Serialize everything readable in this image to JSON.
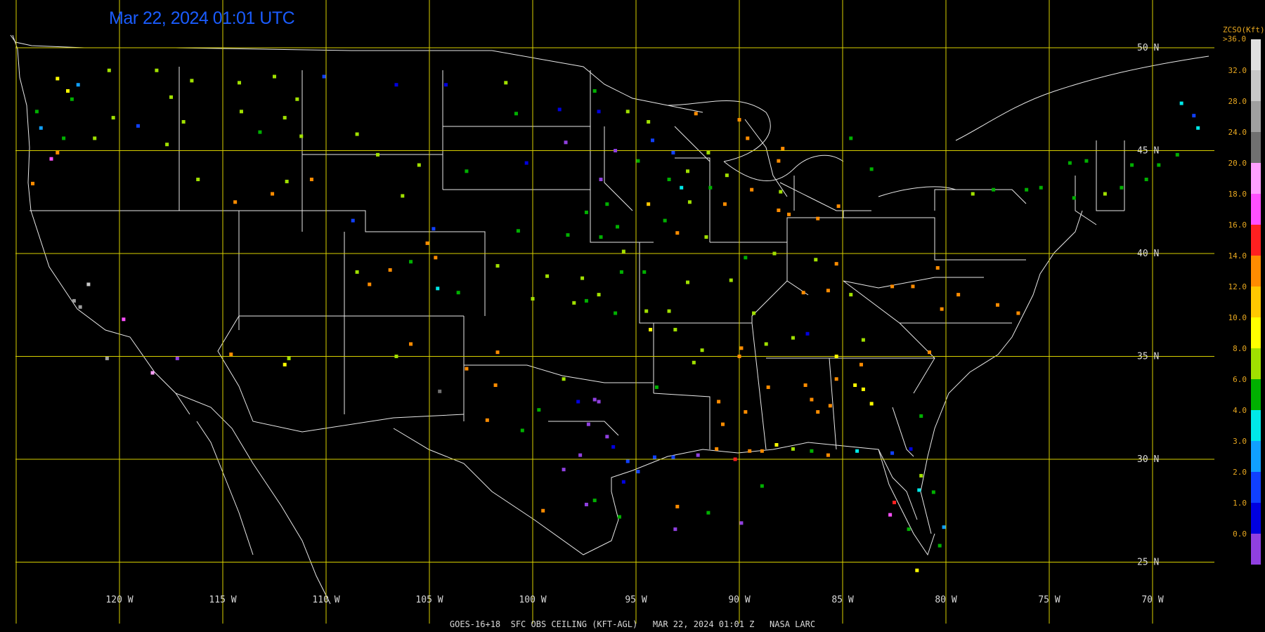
{
  "timestamp": "Mar 22, 2024 01:01 UTC",
  "footer": "GOES-16+18  SFC OBS CEILING (KFT-AGL)   MAR 22, 2024 01:01 Z   NASA LARC",
  "map": {
    "lat_lines": [
      {
        "lat": 50,
        "label": "50 N"
      },
      {
        "lat": 45,
        "label": "45 N"
      },
      {
        "lat": 40,
        "label": "40 N"
      },
      {
        "lat": 35,
        "label": "35 N"
      },
      {
        "lat": 30,
        "label": "30 N"
      },
      {
        "lat": 25,
        "label": "25 N"
      }
    ],
    "lon_lines": [
      {
        "lon": -125,
        "label": ""
      },
      {
        "lon": -120,
        "label": "120 W"
      },
      {
        "lon": -115,
        "label": "115 W"
      },
      {
        "lon": -110,
        "label": "110 W"
      },
      {
        "lon": -105,
        "label": "105 W"
      },
      {
        "lon": -100,
        "label": "100 W"
      },
      {
        "lon": -95,
        "label": "95 W"
      },
      {
        "lon": -90,
        "label": "90 W"
      },
      {
        "lon": -85,
        "label": "85 W"
      },
      {
        "lon": -80,
        "label": "80 W"
      },
      {
        "lon": -75,
        "label": "75 W"
      },
      {
        "lon": -70,
        "label": "70 W"
      }
    ],
    "grid_color": "#d8d000",
    "boundary_color": "#e8e8e8"
  },
  "colorbar": {
    "title": "ZCSO(Kft)",
    "top_label": ">36.0",
    "labels": [
      "32.0",
      "28.0",
      "24.0",
      "20.0",
      "18.0",
      "16.0",
      "14.0",
      "12.0",
      "10.0",
      "8.0",
      "6.0",
      "4.0",
      "3.0",
      "2.0",
      "1.0",
      "0.0"
    ],
    "colors": [
      "#e0e0e0",
      "#c8c8c8",
      "#a0a0a0",
      "#707070",
      "#ffa0ff",
      "#ff50ff",
      "#ff2020",
      "#ff8c00",
      "#ffc800",
      "#ffff00",
      "#a0e000",
      "#00b000",
      "#00e8e8",
      "#10a0ff",
      "#1040ff",
      "#0000e0",
      "#9040e0"
    ]
  },
  "observations": [
    {
      "lon": -122.3,
      "lat": 47.5,
      "v": 5
    },
    {
      "lon": -122.5,
      "lat": 47.9,
      "v": 7
    },
    {
      "lon": -123.0,
      "lat": 48.5,
      "v": 7
    },
    {
      "lon": -122.0,
      "lat": 48.2,
      "v": 3
    },
    {
      "lon": -124.0,
      "lat": 46.9,
      "v": 5
    },
    {
      "lon": -123.8,
      "lat": 46.1,
      "v": 3
    },
    {
      "lon": -122.7,
      "lat": 45.6,
      "v": 5
    },
    {
      "lon": -123.0,
      "lat": 44.9,
      "v": 9
    },
    {
      "lon": -124.2,
      "lat": 43.4,
      "v": 9
    },
    {
      "lon": -123.3,
      "lat": 44.6,
      "v": 11
    },
    {
      "lon": -121.2,
      "lat": 45.6,
      "v": 6
    },
    {
      "lon": -120.3,
      "lat": 46.6,
      "v": 6
    },
    {
      "lon": -119.1,
      "lat": 46.2,
      "v": 2
    },
    {
      "lon": -117.5,
      "lat": 47.6,
      "v": 6
    },
    {
      "lon": -116.9,
      "lat": 46.4,
      "v": 6
    },
    {
      "lon": -120.5,
      "lat": 48.9,
      "v": 6
    },
    {
      "lon": -118.2,
      "lat": 48.9,
      "v": 6
    },
    {
      "lon": -116.5,
      "lat": 48.4,
      "v": 6
    },
    {
      "lon": -114.2,
      "lat": 48.3,
      "v": 6
    },
    {
      "lon": -112.5,
      "lat": 48.6,
      "v": 6
    },
    {
      "lon": -111.4,
      "lat": 47.5,
      "v": 6
    },
    {
      "lon": -110.1,
      "lat": 48.6,
      "v": 2
    },
    {
      "lon": -108.5,
      "lat": 45.8,
      "v": 6
    },
    {
      "lon": -112.0,
      "lat": 46.6,
      "v": 6
    },
    {
      "lon": -114.1,
      "lat": 46.9,
      "v": 6
    },
    {
      "lon": -113.2,
      "lat": 45.9,
      "v": 5
    },
    {
      "lon": -111.2,
      "lat": 45.7,
      "v": 6
    },
    {
      "lon": -106.6,
      "lat": 48.2,
      "v": 1
    },
    {
      "lon": -104.2,
      "lat": 48.2,
      "v": 1
    },
    {
      "lon": -107.5,
      "lat": 44.8,
      "v": 6
    },
    {
      "lon": -105.5,
      "lat": 44.3,
      "v": 6
    },
    {
      "lon": -104.8,
      "lat": 41.2,
      "v": 2
    },
    {
      "lon": -106.3,
      "lat": 42.8,
      "v": 6
    },
    {
      "lon": -108.7,
      "lat": 41.6,
      "v": 2
    },
    {
      "lon": -110.7,
      "lat": 43.6,
      "v": 9
    },
    {
      "lon": -112.6,
      "lat": 42.9,
      "v": 9
    },
    {
      "lon": -111.9,
      "lat": 43.5,
      "v": 6
    },
    {
      "lon": -114.4,
      "lat": 42.5,
      "v": 9
    },
    {
      "lon": -116.2,
      "lat": 43.6,
      "v": 6
    },
    {
      "lon": -117.7,
      "lat": 45.3,
      "v": 6
    },
    {
      "lon": -101.3,
      "lat": 48.3,
      "v": 6
    },
    {
      "lon": -100.8,
      "lat": 46.8,
      "v": 5
    },
    {
      "lon": -98.7,
      "lat": 47.0,
      "v": 1
    },
    {
      "lon": -97.0,
      "lat": 47.9,
      "v": 5
    },
    {
      "lon": -96.8,
      "lat": 46.9,
      "v": 1
    },
    {
      "lon": -98.4,
      "lat": 45.4,
      "v": 0
    },
    {
      "lon": -100.3,
      "lat": 44.4,
      "v": 1
    },
    {
      "lon": -103.2,
      "lat": 44.0,
      "v": 5
    },
    {
      "lon": -96.7,
      "lat": 43.6,
      "v": 0
    },
    {
      "lon": -96.0,
      "lat": 45.0,
      "v": 0
    },
    {
      "lon": -95.4,
      "lat": 46.9,
      "v": 6
    },
    {
      "lon": -94.4,
      "lat": 46.4,
      "v": 6
    },
    {
      "lon": -93.2,
      "lat": 44.9,
      "v": 2
    },
    {
      "lon": -92.5,
      "lat": 44.0,
      "v": 6
    },
    {
      "lon": -94.9,
      "lat": 44.5,
      "v": 5
    },
    {
      "lon": -93.4,
      "lat": 43.6,
      "v": 5
    },
    {
      "lon": -94.2,
      "lat": 45.5,
      "v": 2
    },
    {
      "lon": -92.1,
      "lat": 46.8,
      "v": 9
    },
    {
      "lon": -90.0,
      "lat": 46.5,
      "v": 9
    },
    {
      "lon": -89.6,
      "lat": 45.6,
      "v": 9
    },
    {
      "lon": -91.5,
      "lat": 44.9,
      "v": 6
    },
    {
      "lon": -89.4,
      "lat": 43.1,
      "v": 9
    },
    {
      "lon": -88.0,
      "lat": 43.0,
      "v": 6
    },
    {
      "lon": -88.1,
      "lat": 44.5,
      "v": 9
    },
    {
      "lon": -87.9,
      "lat": 45.1,
      "v": 9
    },
    {
      "lon": -90.6,
      "lat": 43.8,
      "v": 6
    },
    {
      "lon": -91.4,
      "lat": 43.2,
      "v": 5
    },
    {
      "lon": -93.6,
      "lat": 41.6,
      "v": 5
    },
    {
      "lon": -92.4,
      "lat": 42.5,
      "v": 6
    },
    {
      "lon": -90.7,
      "lat": 42.4,
      "v": 9
    },
    {
      "lon": -91.6,
      "lat": 40.8,
      "v": 6
    },
    {
      "lon": -95.9,
      "lat": 41.3,
      "v": 5
    },
    {
      "lon": -94.4,
      "lat": 42.4,
      "v": 8
    },
    {
      "lon": -96.4,
      "lat": 42.4,
      "v": 5
    },
    {
      "lon": -93.0,
      "lat": 41.0,
      "v": 9
    },
    {
      "lon": -92.8,
      "lat": 43.2,
      "v": 4
    },
    {
      "lon": -97.4,
      "lat": 42.0,
      "v": 5
    },
    {
      "lon": -98.3,
      "lat": 40.9,
      "v": 5
    },
    {
      "lon": -100.7,
      "lat": 41.1,
      "v": 5
    },
    {
      "lon": -96.7,
      "lat": 40.8,
      "v": 5
    },
    {
      "lon": -95.6,
      "lat": 40.1,
      "v": 6
    },
    {
      "lon": -97.6,
      "lat": 38.8,
      "v": 6
    },
    {
      "lon": -98.0,
      "lat": 37.6,
      "v": 6
    },
    {
      "lon": -97.4,
      "lat": 37.7,
      "v": 5
    },
    {
      "lon": -96.0,
      "lat": 37.1,
      "v": 5
    },
    {
      "lon": -95.7,
      "lat": 39.1,
      "v": 5
    },
    {
      "lon": -94.6,
      "lat": 39.1,
      "v": 5
    },
    {
      "lon": -96.8,
      "lat": 38.0,
      "v": 6
    },
    {
      "lon": -99.3,
      "lat": 38.9,
      "v": 6
    },
    {
      "lon": -100.0,
      "lat": 37.8,
      "v": 6
    },
    {
      "lon": -101.7,
      "lat": 39.4,
      "v": 6
    },
    {
      "lon": -104.7,
      "lat": 39.8,
      "v": 9
    },
    {
      "lon": -105.1,
      "lat": 40.5,
      "v": 9
    },
    {
      "lon": -105.9,
      "lat": 39.6,
      "v": 5
    },
    {
      "lon": -106.9,
      "lat": 39.2,
      "v": 9
    },
    {
      "lon": -107.9,
      "lat": 38.5,
      "v": 9
    },
    {
      "lon": -108.5,
      "lat": 39.1,
      "v": 6
    },
    {
      "lon": -104.6,
      "lat": 38.3,
      "v": 4
    },
    {
      "lon": -103.6,
      "lat": 38.1,
      "v": 5
    },
    {
      "lon": -105.9,
      "lat": 35.6,
      "v": 9
    },
    {
      "lon": -106.6,
      "lat": 35.0,
      "v": 6
    },
    {
      "lon": -103.2,
      "lat": 34.4,
      "v": 9
    },
    {
      "lon": -101.7,
      "lat": 35.2,
      "v": 9
    },
    {
      "lon": -101.8,
      "lat": 33.6,
      "v": 9
    },
    {
      "lon": -102.2,
      "lat": 31.9,
      "v": 9
    },
    {
      "lon": -100.5,
      "lat": 31.4,
      "v": 5
    },
    {
      "lon": -99.7,
      "lat": 32.4,
      "v": 5
    },
    {
      "lon": -98.5,
      "lat": 33.9,
      "v": 6
    },
    {
      "lon": -97.8,
      "lat": 32.8,
      "v": 1
    },
    {
      "lon": -97.0,
      "lat": 32.9,
      "v": 0
    },
    {
      "lon": -96.8,
      "lat": 32.8,
      "v": 0
    },
    {
      "lon": -97.3,
      "lat": 31.7,
      "v": 0
    },
    {
      "lon": -96.4,
      "lat": 31.1,
      "v": 0
    },
    {
      "lon": -95.4,
      "lat": 29.9,
      "v": 2
    },
    {
      "lon": -94.9,
      "lat": 29.4,
      "v": 2
    },
    {
      "lon": -95.6,
      "lat": 28.9,
      "v": 1
    },
    {
      "lon": -97.7,
      "lat": 30.2,
      "v": 0
    },
    {
      "lon": -98.5,
      "lat": 29.5,
      "v": 0
    },
    {
      "lon": -97.4,
      "lat": 27.8,
      "v": 0
    },
    {
      "lon": -99.5,
      "lat": 27.5,
      "v": 9
    },
    {
      "lon": -96.1,
      "lat": 30.6,
      "v": 1
    },
    {
      "lon": -94.1,
      "lat": 30.1,
      "v": 2
    },
    {
      "lon": -93.2,
      "lat": 30.1,
      "v": 2
    },
    {
      "lon": -92.0,
      "lat": 30.2,
      "v": 0
    },
    {
      "lon": -91.1,
      "lat": 30.5,
      "v": 9
    },
    {
      "lon": -90.2,
      "lat": 30.0,
      "v": 10
    },
    {
      "lon": -89.5,
      "lat": 30.4,
      "v": 9
    },
    {
      "lon": -88.9,
      "lat": 30.4,
      "v": 9
    },
    {
      "lon": -88.2,
      "lat": 30.7,
      "v": 7
    },
    {
      "lon": -87.4,
      "lat": 30.5,
      "v": 6
    },
    {
      "lon": -86.5,
      "lat": 30.4,
      "v": 5
    },
    {
      "lon": -85.7,
      "lat": 30.2,
      "v": 9
    },
    {
      "lon": -84.3,
      "lat": 30.4,
      "v": 4
    },
    {
      "lon": -82.6,
      "lat": 30.3,
      "v": 2
    },
    {
      "lon": -81.7,
      "lat": 30.5,
      "v": 1
    },
    {
      "lon": -81.2,
      "lat": 29.2,
      "v": 6
    },
    {
      "lon": -80.6,
      "lat": 28.4,
      "v": 5
    },
    {
      "lon": -81.3,
      "lat": 28.5,
      "v": 4
    },
    {
      "lon": -82.5,
      "lat": 27.9,
      "v": 10
    },
    {
      "lon": -82.7,
      "lat": 27.3,
      "v": 11
    },
    {
      "lon": -81.8,
      "lat": 26.6,
      "v": 5
    },
    {
      "lon": -80.3,
      "lat": 25.8,
      "v": 5
    },
    {
      "lon": -80.1,
      "lat": 26.7,
      "v": 3
    },
    {
      "lon": -81.4,
      "lat": 24.6,
      "v": 7
    },
    {
      "lon": -94.5,
      "lat": 37.2,
      "v": 6
    },
    {
      "lon": -93.4,
      "lat": 37.2,
      "v": 6
    },
    {
      "lon": -92.5,
      "lat": 38.6,
      "v": 6
    },
    {
      "lon": -90.4,
      "lat": 38.7,
      "v": 6
    },
    {
      "lon": -89.3,
      "lat": 37.1,
      "v": 6
    },
    {
      "lon": -92.2,
      "lat": 34.7,
      "v": 6
    },
    {
      "lon": -94.3,
      "lat": 36.3,
      "v": 7
    },
    {
      "lon": -93.1,
      "lat": 36.3,
      "v": 6
    },
    {
      "lon": -91.8,
      "lat": 35.3,
      "v": 6
    },
    {
      "lon": -94.0,
      "lat": 33.5,
      "v": 5
    },
    {
      "lon": -90.0,
      "lat": 35.0,
      "v": 9
    },
    {
      "lon": -89.9,
      "lat": 35.4,
      "v": 9
    },
    {
      "lon": -88.7,
      "lat": 35.6,
      "v": 6
    },
    {
      "lon": -87.4,
      "lat": 35.9,
      "v": 6
    },
    {
      "lon": -86.7,
      "lat": 36.1,
      "v": 1
    },
    {
      "lon": -85.3,
      "lat": 35.0,
      "v": 7
    },
    {
      "lon": -84.0,
      "lat": 35.8,
      "v": 6
    },
    {
      "lon": -89.7,
      "lat": 32.3,
      "v": 9
    },
    {
      "lon": -88.6,
      "lat": 33.5,
      "v": 9
    },
    {
      "lon": -86.8,
      "lat": 33.6,
      "v": 9
    },
    {
      "lon": -86.2,
      "lat": 32.3,
      "v": 9
    },
    {
      "lon": -85.6,
      "lat": 32.6,
      "v": 9
    },
    {
      "lon": -84.4,
      "lat": 33.6,
      "v": 7
    },
    {
      "lon": -84.0,
      "lat": 33.4,
      "v": 7
    },
    {
      "lon": -83.6,
      "lat": 32.7,
      "v": 7
    },
    {
      "lon": -81.2,
      "lat": 32.1,
      "v": 5
    },
    {
      "lon": -86.9,
      "lat": 38.1,
      "v": 9
    },
    {
      "lon": -85.7,
      "lat": 38.2,
      "v": 9
    },
    {
      "lon": -84.6,
      "lat": 38.0,
      "v": 6
    },
    {
      "lon": -82.6,
      "lat": 38.4,
      "v": 9
    },
    {
      "lon": -81.6,
      "lat": 38.4,
      "v": 9
    },
    {
      "lon": -80.2,
      "lat": 37.3,
      "v": 9
    },
    {
      "lon": -79.4,
      "lat": 38.0,
      "v": 9
    },
    {
      "lon": -77.5,
      "lat": 37.5,
      "v": 9
    },
    {
      "lon": -76.5,
      "lat": 37.1,
      "v": 9
    },
    {
      "lon": -80.4,
      "lat": 39.3,
      "v": 9
    },
    {
      "lon": -86.3,
      "lat": 39.7,
      "v": 6
    },
    {
      "lon": -88.3,
      "lat": 40.0,
      "v": 6
    },
    {
      "lon": -89.7,
      "lat": 39.8,
      "v": 5
    },
    {
      "lon": -87.6,
      "lat": 41.9,
      "v": 9
    },
    {
      "lon": -88.1,
      "lat": 42.1,
      "v": 9
    },
    {
      "lon": -86.2,
      "lat": 41.7,
      "v": 9
    },
    {
      "lon": -85.2,
      "lat": 42.3,
      "v": 9
    },
    {
      "lon": -83.6,
      "lat": 44.1,
      "v": 5
    },
    {
      "lon": -84.6,
      "lat": 45.6,
      "v": 5
    },
    {
      "lon": -78.7,
      "lat": 42.9,
      "v": 6
    },
    {
      "lon": -77.7,
      "lat": 43.1,
      "v": 5
    },
    {
      "lon": -76.1,
      "lat": 43.1,
      "v": 5
    },
    {
      "lon": -75.4,
      "lat": 43.2,
      "v": 5
    },
    {
      "lon": -73.8,
      "lat": 42.7,
      "v": 5
    },
    {
      "lon": -74.0,
      "lat": 44.4,
      "v": 5
    },
    {
      "lon": -73.2,
      "lat": 44.5,
      "v": 5
    },
    {
      "lon": -71.5,
      "lat": 43.2,
      "v": 5
    },
    {
      "lon": -70.3,
      "lat": 43.6,
      "v": 5
    },
    {
      "lon": -68.8,
      "lat": 44.8,
      "v": 5
    },
    {
      "lon": -68.0,
      "lat": 46.7,
      "v": 2
    },
    {
      "lon": -72.3,
      "lat": 42.9,
      "v": 6
    },
    {
      "lon": -71.0,
      "lat": 44.3,
      "v": 5
    },
    {
      "lon": -69.7,
      "lat": 44.3,
      "v": 5
    },
    {
      "lon": -68.6,
      "lat": 47.3,
      "v": 4
    },
    {
      "lon": -67.8,
      "lat": 46.1,
      "v": 4
    },
    {
      "lon": -121.5,
      "lat": 38.5,
      "v": 15
    },
    {
      "lon": -122.2,
      "lat": 37.7,
      "v": 14
    },
    {
      "lon": -121.9,
      "lat": 37.4,
      "v": 14
    },
    {
      "lon": -119.8,
      "lat": 36.8,
      "v": 11
    },
    {
      "lon": -120.6,
      "lat": 34.9,
      "v": 14
    },
    {
      "lon": -117.2,
      "lat": 34.9,
      "v": 0
    },
    {
      "lon": -118.4,
      "lat": 34.2,
      "v": 12
    },
    {
      "lon": -114.6,
      "lat": 35.1,
      "v": 9
    },
    {
      "lon": -112.0,
      "lat": 34.6,
      "v": 7
    },
    {
      "lon": -111.8,
      "lat": 34.9,
      "v": 6
    },
    {
      "lon": -104.5,
      "lat": 33.3,
      "v": 13
    },
    {
      "lon": -97.0,
      "lat": 28.0,
      "v": 5
    },
    {
      "lon": -95.8,
      "lat": 27.2,
      "v": 5
    },
    {
      "lon": -93.0,
      "lat": 27.7,
      "v": 9
    },
    {
      "lon": -91.5,
      "lat": 27.4,
      "v": 5
    },
    {
      "lon": -88.9,
      "lat": 28.7,
      "v": 5
    },
    {
      "lon": -93.1,
      "lat": 26.6,
      "v": 0
    },
    {
      "lon": -89.9,
      "lat": 26.9,
      "v": 0
    },
    {
      "lon": -85.3,
      "lat": 39.5,
      "v": 9
    },
    {
      "lon": -84.1,
      "lat": 34.6,
      "v": 9
    },
    {
      "lon": -86.5,
      "lat": 32.9,
      "v": 9
    },
    {
      "lon": -80.8,
      "lat": 35.2,
      "v": 9
    },
    {
      "lon": -85.3,
      "lat": 33.9,
      "v": 9
    },
    {
      "lon": -90.8,
      "lat": 31.7,
      "v": 9
    },
    {
      "lon": -91.0,
      "lat": 32.8,
      "v": 9
    }
  ]
}
